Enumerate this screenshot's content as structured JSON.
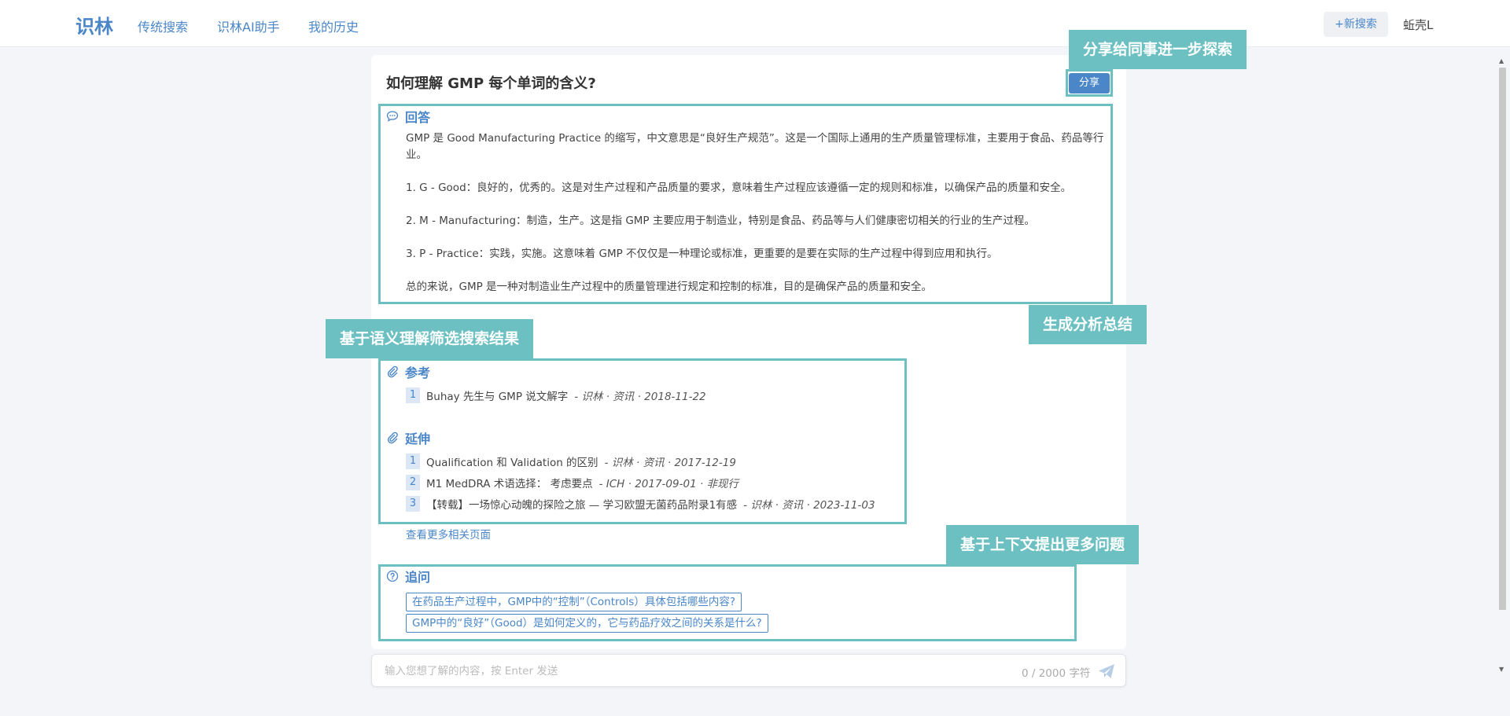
{
  "header": {
    "logo": "识林",
    "nav": [
      "传统搜索",
      "识林AI助手",
      "我的历史"
    ],
    "new_search_label": "+新搜索",
    "user_name": "蚯壳L"
  },
  "question": {
    "title": "如何理解 GMP 每个单词的含义?",
    "share_label": "分享"
  },
  "answer": {
    "heading": "回答",
    "paragraphs": [
      "GMP 是 Good Manufacturing Practice 的缩写，中文意思是“良好生产规范”。这是一个国际上通用的生产质量管理标准，主要用于食品、药品等行业。",
      "1. G - Good：良好的，优秀的。这是对生产过程和产品质量的要求，意味着生产过程应该遵循一定的规则和标准，以确保产品的质量和安全。",
      "2. M - Manufacturing：制造，生产。这是指 GMP 主要应用于制造业，特别是食品、药品等与人们健康密切相关的行业的生产过程。",
      "3. P - Practice：实践，实施。这意味着 GMP 不仅仅是一种理论或标准，更重要的是要在实际的生产过程中得到应用和执行。",
      "总的来说，GMP 是一种对制造业生产过程中的质量管理进行规定和控制的标准，目的是确保产品的质量和安全。"
    ]
  },
  "references": {
    "heading": "参考",
    "items": [
      {
        "num": "1",
        "title": "Buhay 先生与 GMP 说文解字",
        "meta": "- 识林 · 资讯 · 2018-11-22"
      }
    ]
  },
  "extensions": {
    "heading": "延伸",
    "items": [
      {
        "num": "1",
        "title": "Qualification 和 Validation 的区别",
        "meta": "- 识林 · 资讯 · 2017-12-19"
      },
      {
        "num": "2",
        "title": "M1 MedDRA 术语选择： 考虑要点",
        "meta": "- ICH · 2017-09-01 · 非现行"
      },
      {
        "num": "3",
        "title": "【转载】一场惊心动魄的探险之旅 — 学习欧盟无菌药品附录1有感",
        "meta": "- 识林 · 资讯 · 2023-11-03"
      }
    ],
    "more_label": "查看更多相关页面"
  },
  "followup": {
    "heading": "追问",
    "items": [
      "在药品生产过程中，GMP中的“控制”（Controls）具体包括哪些内容?",
      "GMP中的“良好”（Good）是如何定义的，它与药品疗效之间的关系是什么?"
    ]
  },
  "callouts": {
    "share": "分享给同事进一步探索",
    "summary": "生成分析总结",
    "filter": "基于语义理解筛选搜索结果",
    "context": "基于上下文提出更多问题"
  },
  "input": {
    "placeholder": "输入您想了解的内容，按 Enter 发送",
    "counter": "0 / 2000 字符"
  },
  "colors": {
    "accent": "#4a86c8",
    "highlight": "#6cc0c2"
  }
}
